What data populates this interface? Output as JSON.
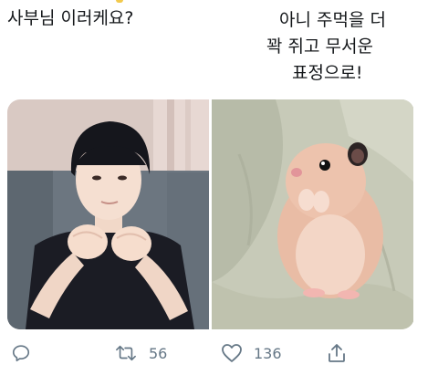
{
  "caption": {
    "left": "사부님 이러케요?",
    "right_lines": [
      "아니 주먹을 더",
      "꽉 쥐고 무서운",
      "표정으로!"
    ]
  },
  "media": {
    "left_photo": "person-fists-photo",
    "right_photo": "hamster-photo"
  },
  "actions": {
    "reply_icon": "reply-icon",
    "retweet_icon": "retweet-icon",
    "retweet_count": "56",
    "like_icon": "heart-icon",
    "like_count": "136",
    "share_icon": "share-icon"
  },
  "colors": {
    "text": "#14171a",
    "muted": "#657786",
    "background": "#ffffff"
  }
}
